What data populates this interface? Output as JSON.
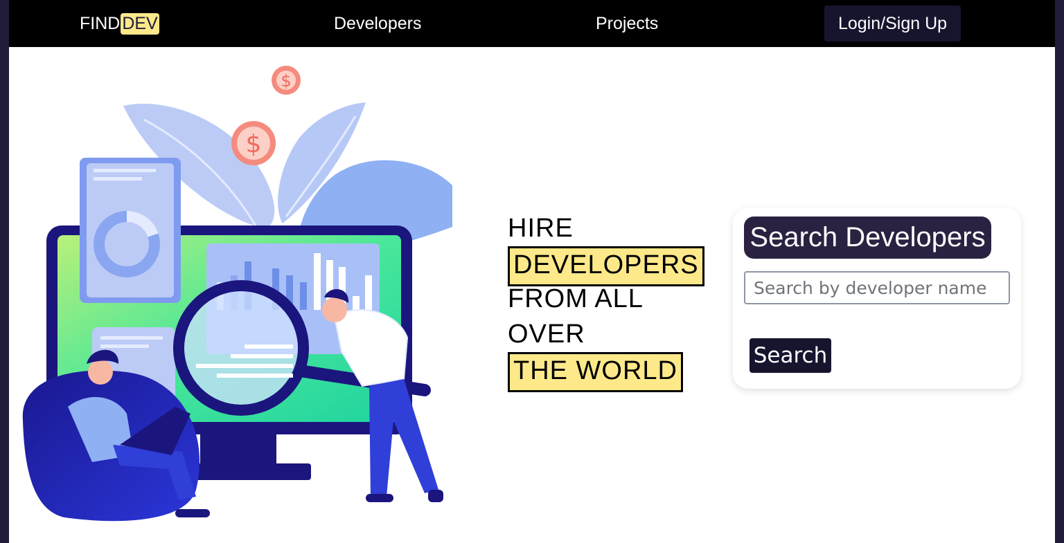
{
  "nav": {
    "logo_part1": "FIND",
    "logo_part2": "DEV",
    "links": [
      "Developers",
      "Projects"
    ],
    "login_label": "Login/Sign Up"
  },
  "hero": {
    "line1": "HIRE",
    "line2": "DEVELOPERS",
    "line3": "FROM ALL",
    "line4": "OVER",
    "line5": "THE WORLD"
  },
  "search": {
    "title": "Search Developers",
    "placeholder": "Search by developer name",
    "button_label": "Search"
  },
  "colors": {
    "page_background": "#201c3a",
    "navbar": "#000000",
    "highlight": "#fde98a",
    "dark_button": "#17152e",
    "card_title_bg": "#2a2240"
  }
}
